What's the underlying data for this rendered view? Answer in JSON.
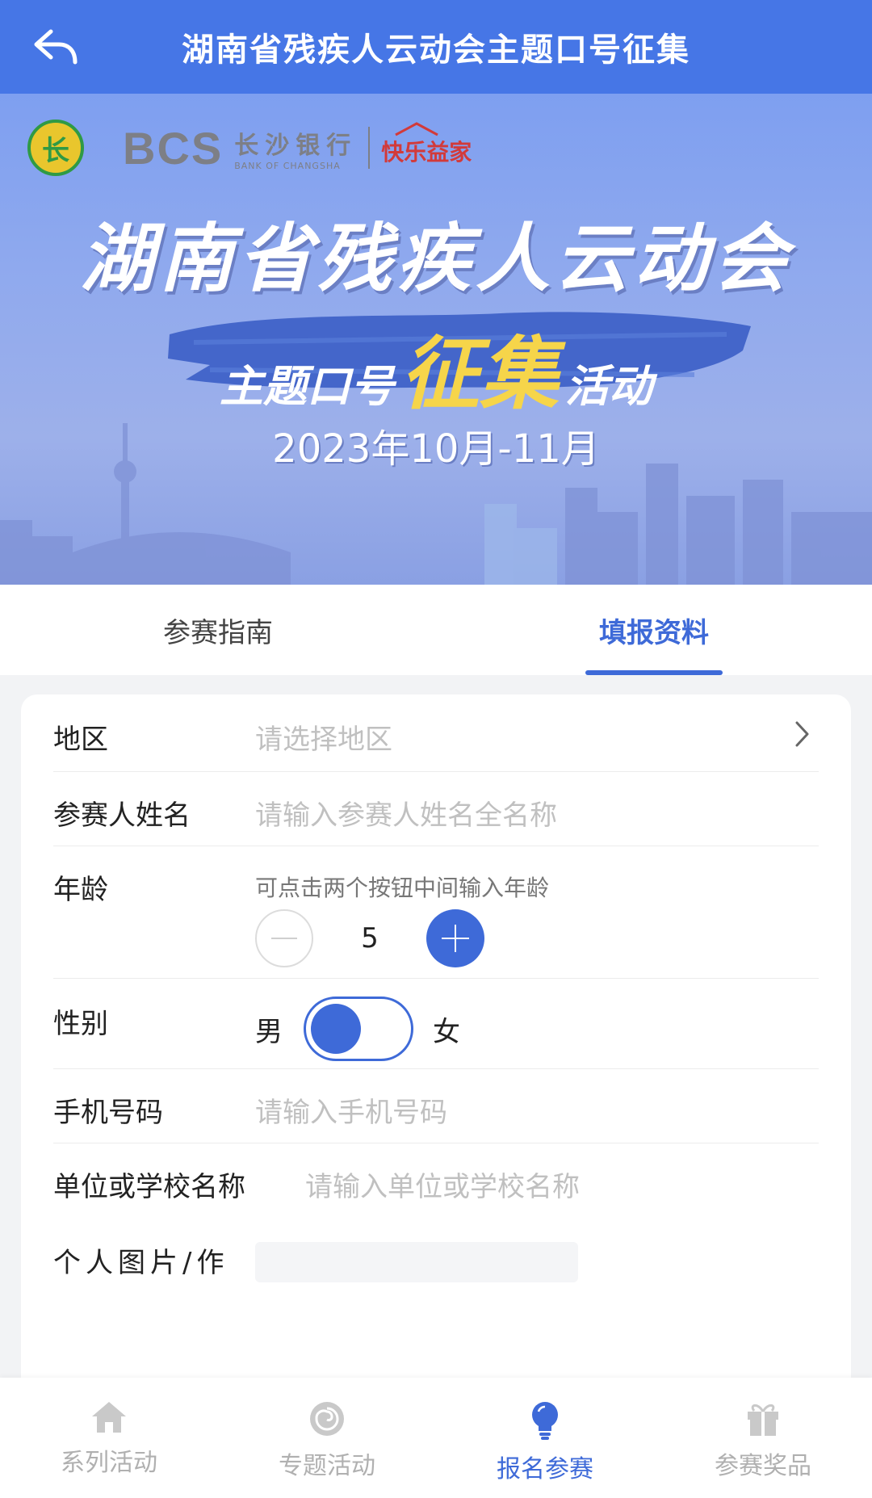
{
  "header": {
    "title": "湖南省残疾人云动会主题口号征集"
  },
  "banner": {
    "logos": {
      "badge": "长",
      "bcs": "BCS",
      "bank_cn": "长沙银行",
      "bank_en": "BANK OF CHANGSHA",
      "joy": "快乐益家"
    },
    "headline": "湖南省残疾人云动会",
    "subline_left": "主题口号",
    "subline_big": "征集",
    "subline_right": "活动",
    "date": "2023年10月-11月"
  },
  "tabs": [
    {
      "label": "参赛指南",
      "active": false
    },
    {
      "label": "填报资料",
      "active": true
    }
  ],
  "form": {
    "region": {
      "label": "地区",
      "placeholder": "请选择地区"
    },
    "name": {
      "label": "参赛人姓名",
      "placeholder": "请输入参赛人姓名全名称"
    },
    "age": {
      "label": "年龄",
      "hint": "可点击两个按钮中间输入年龄",
      "value": "5"
    },
    "gender": {
      "label": "性别",
      "male": "男",
      "female": "女",
      "selected": "男"
    },
    "phone": {
      "label": "手机号码",
      "placeholder": "请输入手机号码"
    },
    "org": {
      "label": "单位或学校名称",
      "placeholder": "请输入单位或学校名称"
    },
    "work": {
      "label": "个人图片/作"
    }
  },
  "bottom_nav": [
    {
      "label": "系列活动",
      "icon": "home-icon",
      "active": false
    },
    {
      "label": "专题活动",
      "icon": "swirl-icon",
      "active": false
    },
    {
      "label": "报名参赛",
      "icon": "lightbulb-icon",
      "active": true
    },
    {
      "label": "参赛奖品",
      "icon": "gift-icon",
      "active": false
    }
  ],
  "colors": {
    "primary": "#4676e6",
    "accent": "#3e6ad8",
    "placeholder": "#c0c0c0"
  }
}
